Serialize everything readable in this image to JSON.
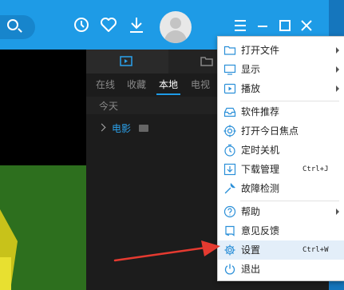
{
  "colors": {
    "titlebar": "#1e9be6",
    "accent": "#2ba2ec",
    "menu_bg": "#ffffff",
    "arrow": "#e53a30"
  },
  "titlebar": {
    "icons": [
      "search-icon",
      "clock-icon",
      "heart-icon",
      "download-icon",
      "avatar",
      "menu-icon",
      "minimize-icon",
      "maximize-icon",
      "close-icon"
    ]
  },
  "panel": {
    "tabs": [
      "play-list-icon",
      "folder-icon"
    ],
    "subtabs": [
      "在线",
      "收藏",
      "本地",
      "电视"
    ],
    "active_subtab": "本地",
    "group_label": "今天",
    "folder": "电影"
  },
  "menu": {
    "items": [
      {
        "label": "打开文件",
        "icon": "folder-icon",
        "submenu": true
      },
      {
        "label": "显示",
        "icon": "monitor-icon",
        "submenu": true
      },
      {
        "label": "播放",
        "icon": "play-icon",
        "submenu": true
      },
      {
        "label": "软件推荐",
        "icon": "inbox-icon"
      },
      {
        "label": "打开今日焦点",
        "icon": "target-icon"
      },
      {
        "label": "定时关机",
        "icon": "timer-icon"
      },
      {
        "label": "下载管理",
        "icon": "download-icon",
        "shortcut": "Ctrl+J"
      },
      {
        "label": "故障检测",
        "icon": "wrench-icon"
      },
      {
        "label": "帮助",
        "icon": "help-icon",
        "submenu": true
      },
      {
        "label": "意见反馈",
        "icon": "feedback-icon"
      },
      {
        "label": "设置",
        "icon": "gear-icon",
        "shortcut": "Ctrl+W",
        "highlighted": true
      },
      {
        "label": "退出",
        "icon": "power-icon"
      }
    ]
  }
}
